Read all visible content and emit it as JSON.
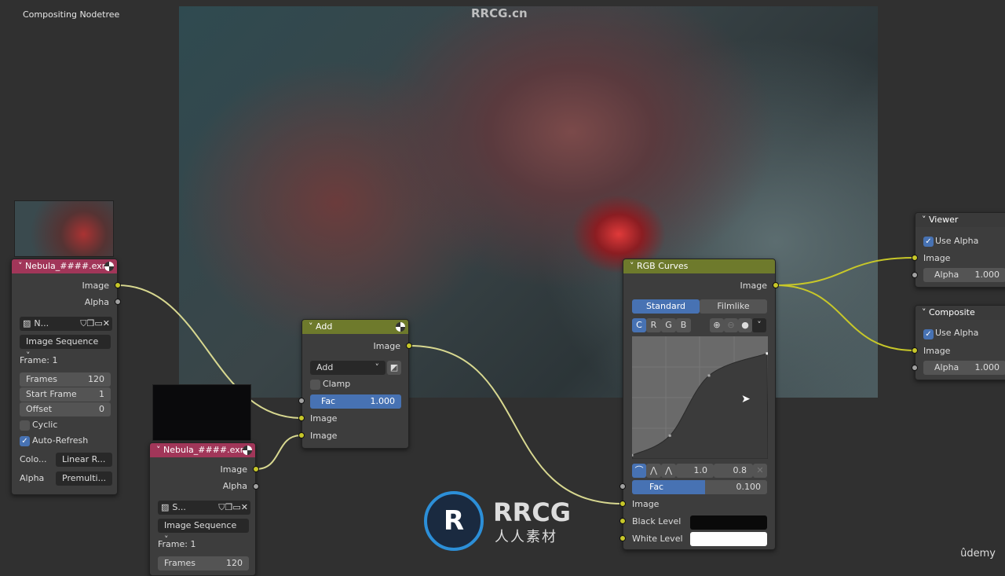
{
  "editor_title": "Compositing Nodetree",
  "watermark": "RRCG.cn",
  "logo": {
    "line1": "RRCG",
    "line2": "人人素材"
  },
  "brand": "ûdemy",
  "image_node_1": {
    "title": "Nebula_####.exr",
    "outputs": [
      "Image",
      "Alpha"
    ],
    "image_name": "N...",
    "source": "Image Sequence",
    "frame_label": "Frame: 1",
    "frames_label": "Frames",
    "frames": "120",
    "start_label": "Start Frame",
    "start": "1",
    "offset_label": "Offset",
    "offset": "0",
    "cyclic": "Cyclic",
    "cyclic_checked": false,
    "auto_refresh": "Auto-Refresh",
    "auto_refresh_checked": true,
    "color_label": "Colo...",
    "color_value": "Linear R...",
    "alpha_label": "Alpha",
    "alpha_value": "Premulti..."
  },
  "image_node_2": {
    "title": "Nebula_####.exr",
    "outputs": [
      "Image",
      "Alpha"
    ],
    "image_name": "S...",
    "source": "Image Sequence",
    "frame_label": "Frame: 1",
    "frames_label": "Frames",
    "frames": "120"
  },
  "add_node": {
    "title": "Add",
    "output": "Image",
    "blend_mode": "Add",
    "clamp": "Clamp",
    "clamp_checked": false,
    "fac_label": "Fac",
    "fac": "1.000",
    "inputs": [
      "Image",
      "Image"
    ]
  },
  "curves_node": {
    "title": "RGB Curves",
    "output": "Image",
    "tabs": [
      "Standard",
      "Filmlike"
    ],
    "active_tab": "Standard",
    "channels": [
      "C",
      "R",
      "G",
      "B"
    ],
    "active_channel": "C",
    "curve_points": [
      [
        0,
        0.03
      ],
      [
        0.28,
        0.19
      ],
      [
        0.57,
        0.68
      ],
      [
        1,
        0.86
      ]
    ],
    "handle_x": "1.0",
    "handle_y": "0.8",
    "fac_label": "Fac",
    "fac": "0.100",
    "inputs": [
      "Image",
      "Black Level",
      "White Level"
    ],
    "black_level": "#000000",
    "white_level": "#ffffff"
  },
  "viewer_node": {
    "title": "Viewer",
    "use_alpha": "Use Alpha",
    "use_alpha_checked": true,
    "input": "Image",
    "alpha_label": "Alpha",
    "alpha": "1.000"
  },
  "composite_node": {
    "title": "Composite",
    "use_alpha": "Use Alpha",
    "use_alpha_checked": true,
    "input": "Image",
    "alpha_label": "Alpha",
    "alpha": "1.000"
  },
  "colors": {
    "image_header": "#a13659",
    "color_header": "#6e7a2c",
    "socket_color": "#c7c729",
    "accent": "#4772b3"
  }
}
